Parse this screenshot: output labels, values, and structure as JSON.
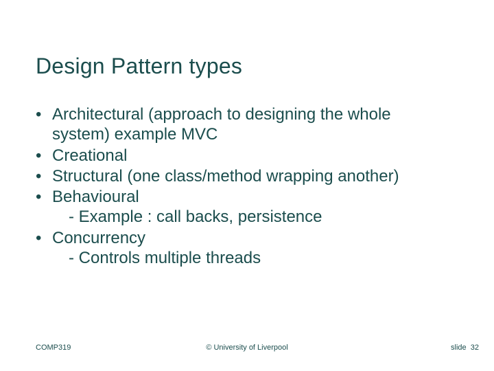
{
  "title": "Design Pattern types",
  "bullets": {
    "b0": "Architectural (approach to designing the whole system) example MVC",
    "b1": "Creational",
    "b2": "Structural (one class/method wrapping another)",
    "b3": "Behavioural",
    "b3_sub": "- Example : call backs, persistence",
    "b4": "Concurrency",
    "b4_sub": "- Controls multiple threads"
  },
  "footer": {
    "course": "COMP319",
    "copyright": "© University of Liverpool",
    "slide_label": "slide",
    "slide_number": "32"
  }
}
